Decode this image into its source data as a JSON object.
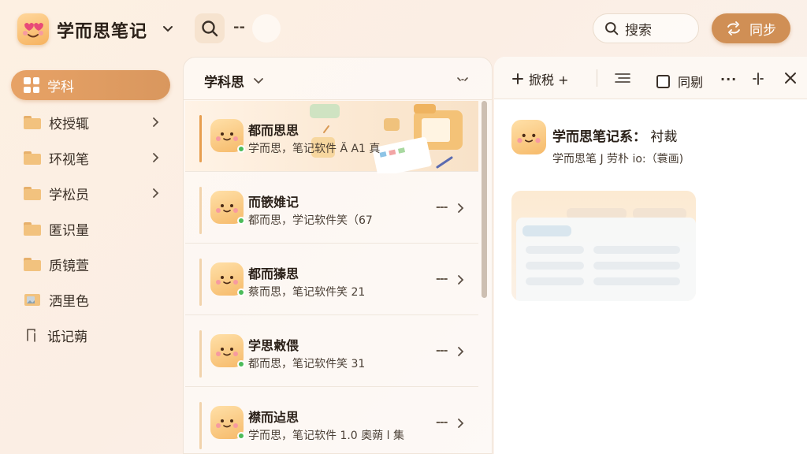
{
  "app": {
    "title": "学而思笔记",
    "search_label": "搜索",
    "sync_label": "同步",
    "top_dash": "--"
  },
  "sidebar": {
    "items": [
      {
        "label": "学科",
        "icon": "grid-icon",
        "active": true,
        "has_chevron": false
      },
      {
        "label": "校授辄",
        "icon": "folder-icon",
        "active": false,
        "has_chevron": true
      },
      {
        "label": "环视笔",
        "icon": "folder-icon",
        "active": false,
        "has_chevron": true
      },
      {
        "label": "学松员",
        "icon": "folder-icon",
        "active": false,
        "has_chevron": true
      },
      {
        "label": "匿识量",
        "icon": "folder-icon",
        "active": false,
        "has_chevron": false
      },
      {
        "label": "质镜萱",
        "icon": "folder-icon",
        "active": false,
        "has_chevron": false
      },
      {
        "label": "洒里色",
        "icon": "image-folder-icon",
        "active": false,
        "has_chevron": false
      },
      {
        "label": "诋记蒴",
        "icon": "bookmark-icon",
        "active": false,
        "has_chevron": false
      }
    ]
  },
  "list": {
    "title": "学科思",
    "notes": [
      {
        "title": "都而思思",
        "subtitle": "学而思，笔记软件 Ä A1 真",
        "selected": true
      },
      {
        "title": "而篏婎记",
        "subtitle": "都而思，学记软件笑（67",
        "selected": false
      },
      {
        "title": "都而獉思",
        "subtitle": "蔡而思，笔记软件笑 21",
        "selected": false
      },
      {
        "title": "学思敹偎",
        "subtitle": "都而思，笔记软件笑 31",
        "selected": false
      },
      {
        "title": "襟而迠思",
        "subtitle": "学而思，笔记软件 1.0 奧蒴 l 集",
        "selected": false
      }
    ],
    "row_more": "---"
  },
  "detail": {
    "toolbar": {
      "add_label": "掀税 +",
      "check_label": "同剔",
      "more": "···"
    },
    "title": "学而思笔记系：",
    "title_suffix": "衬裁",
    "subtitle": "学而思笔 J 劳朴 io:（蓑画)"
  },
  "colors": {
    "accent": "#d9975e",
    "sync_button": "#d08f55",
    "online": "#4cbb5a"
  }
}
